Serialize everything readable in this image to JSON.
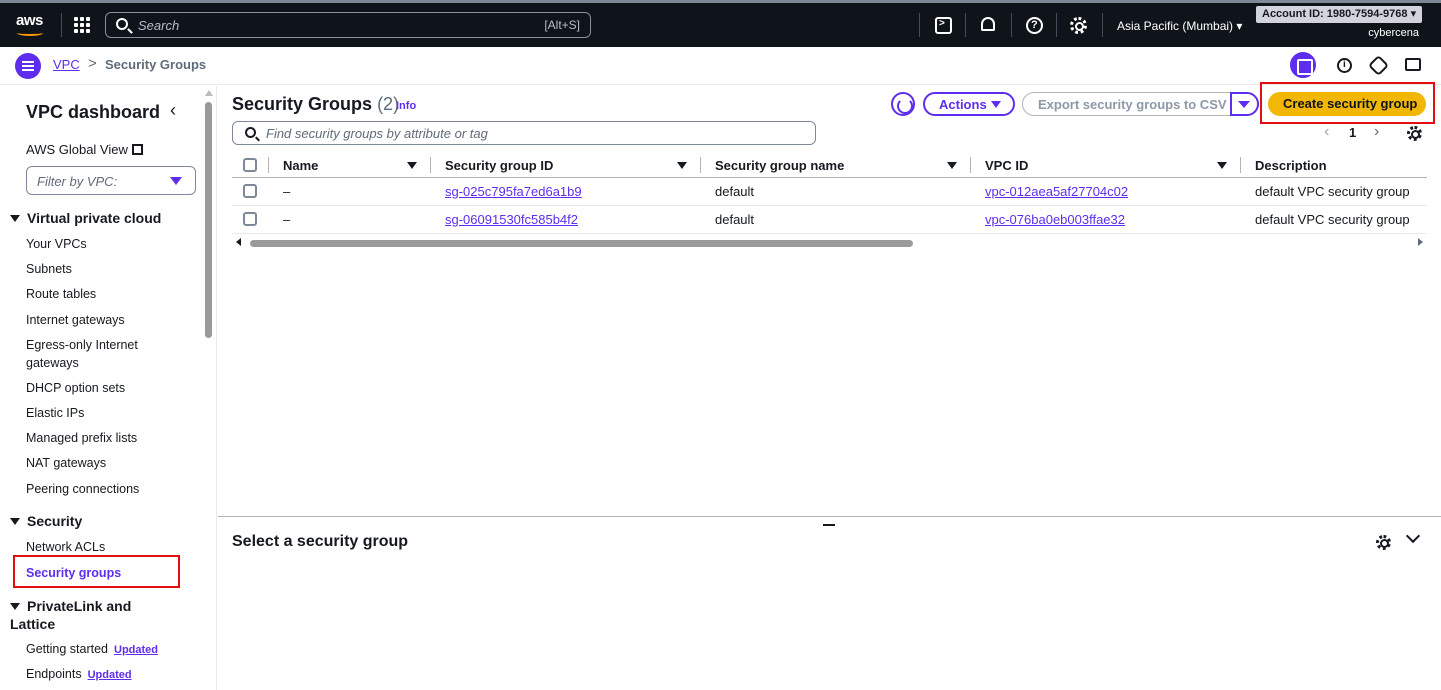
{
  "topnav": {
    "logo": "aws",
    "search_placeholder": "Search",
    "search_shortcut": "[Alt+S]",
    "region": "Asia Pacific (Mumbai) ▾",
    "account": "Account ID: 1980-7594-9768 ▾",
    "user": "cybercena"
  },
  "breadcrumb": {
    "root": "VPC",
    "separator": ">",
    "current": "Security Groups"
  },
  "sidebar": {
    "title": "VPC dashboard",
    "close": "‹",
    "global_view": "AWS Global View",
    "filter_placeholder": "Filter by VPC:",
    "sections": {
      "vpc": "Virtual private cloud",
      "security": "Security",
      "privatelink": "PrivateLink and Lattice"
    },
    "vpc_items": [
      "Your VPCs",
      "Subnets",
      "Route tables",
      "Internet gateways",
      "Egress-only Internet gateways",
      "DHCP option sets",
      "Elastic IPs",
      "Managed prefix lists",
      "NAT gateways",
      "Peering connections"
    ],
    "security_items": [
      "Network ACLs",
      "Security groups"
    ],
    "privatelink_items": [
      "Getting started",
      "Endpoints"
    ],
    "badge": "Updated"
  },
  "main": {
    "title": "Security Groups",
    "count": "(2)",
    "info": "Info",
    "actions": "Actions",
    "export": "Export security groups to CSV",
    "create": "Create security group",
    "find_placeholder": "Find security groups by attribute or tag",
    "pager": {
      "prev": "‹",
      "page": "1",
      "next": "›"
    }
  },
  "table": {
    "columns": [
      "Name",
      "Security group ID",
      "Security group name",
      "VPC ID",
      "Description"
    ],
    "rows": [
      {
        "name": "–",
        "sg_id": "sg-025c795fa7ed6a1b9",
        "sg_name": "default",
        "vpc_id": "vpc-012aea5af27704c02",
        "description": "default VPC security group"
      },
      {
        "name": "–",
        "sg_id": "sg-06091530fc585b4f2",
        "sg_name": "default",
        "vpc_id": "vpc-076ba0eb003ffae32",
        "description": "default VPC security group"
      }
    ]
  },
  "split_panel": {
    "title": "Select a security group"
  },
  "colors": {
    "accent": "#5f2ded",
    "primary_button": "#f2b705",
    "highlight": "#e10f0f",
    "topnav_bg": "#0f141a"
  }
}
